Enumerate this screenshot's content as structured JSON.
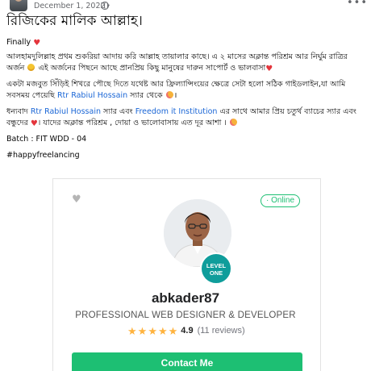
{
  "post": {
    "date": "December 1, 2022 ·",
    "more_label": "•••",
    "title": "রিজিকের মালিক আল্লাহ।",
    "paragraphs": {
      "p1": "Finally",
      "p2_a": "আলহামদুলিল্লাহ প্রথম শুকরিয়া আদায় করি আল্লাহ তায়ালার কাছে। এ ২ মাসের অক্লান্ত পরিশ্রম আর নির্ঘুম রাত্রির অর্জন",
      "p2_b": "এই অর্জনের পিছনে আছে প্রানপ্রিয় কিছু মানুষের দারুন সাপোর্ট ও ভালবাসা",
      "p3_a": "একটা মজবুত সিঁড়িই শিখরে পৌছে দিতে যথেষ্ট আর ফ্রিল্যান্সিংয়ের ক্ষেত্রে সেটা হলো সঠিক গাইডলাইন,যা আমি সবসময় পেয়েছি",
      "p3_link": "Rtr Rabiul Hossain",
      "p3_b": "স্যার থেকে",
      "p4_a": "ধন্যবাদ",
      "p4_link1": "Rtr Rabiul Hossain",
      "p4_b": "স্যার এবং",
      "p4_link2": "Freedom it Institution",
      "p4_c": "এর সাথে আমার প্রিয় চতুর্থ ব্যাচের স্যার এবং বন্ধুদের",
      "p4_d": "। যাদের অক্লান্ত পরিশ্রম , দোয়া ও ভালোবাসায় এত দূর আশা ।",
      "p5": "Batch : FIT WDD - 04",
      "p6": "#happyfreelancing"
    },
    "emoji_names": [
      "heart",
      "star-struck-face",
      "heart",
      "smiling-face-with-hearts",
      "heart",
      "smiling-face-with-hearts"
    ]
  },
  "profile_card": {
    "online_label": "· Online",
    "level_badge_line1": "LEVEL",
    "level_badge_line2": "ONE",
    "username": "abkader87",
    "tagline": "PROFESSIONAL WEB DESIGNER & DEVELOPER",
    "rating": {
      "stars": 5,
      "value": "4.9",
      "reviews": "(11 reviews)"
    },
    "contact_label": "Contact Me",
    "colors": {
      "accent": "#1dbf73",
      "level_badge": "#0f9d9b",
      "star": "#ffb33e",
      "link": "#1a66d6"
    }
  }
}
